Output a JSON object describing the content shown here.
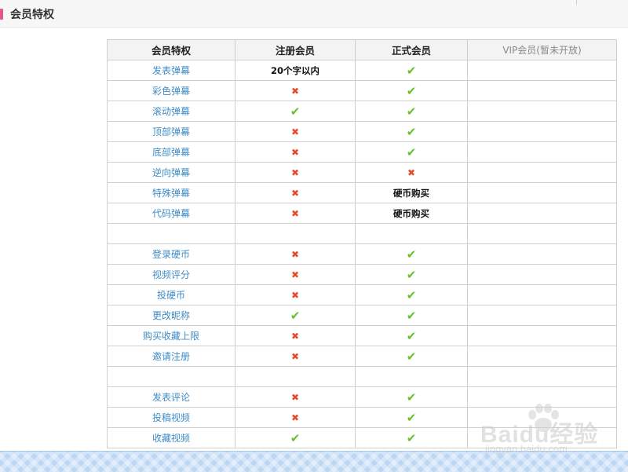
{
  "header": {
    "title": "会员特权"
  },
  "table": {
    "columns": [
      "会员特权",
      "注册会员",
      "正式会员",
      "VIP会员(暂未开放)"
    ],
    "rows": [
      {
        "feature": "发表弹幕",
        "registered": "20个字以内",
        "official": "yes",
        "vip": ""
      },
      {
        "feature": "彩色弹幕",
        "registered": "no",
        "official": "yes",
        "vip": ""
      },
      {
        "feature": "滚动弹幕",
        "registered": "yes",
        "official": "yes",
        "vip": ""
      },
      {
        "feature": "顶部弹幕",
        "registered": "no",
        "official": "yes",
        "vip": ""
      },
      {
        "feature": "底部弹幕",
        "registered": "no",
        "official": "yes",
        "vip": ""
      },
      {
        "feature": "逆向弹幕",
        "registered": "no",
        "official": "no",
        "vip": ""
      },
      {
        "feature": "特殊弹幕",
        "registered": "no",
        "official": "硬币购买",
        "vip": ""
      },
      {
        "feature": "代码弹幕",
        "registered": "no",
        "official": "硬币购买",
        "vip": ""
      },
      {
        "feature": "",
        "registered": "",
        "official": "",
        "vip": ""
      },
      {
        "feature": "登录硬币",
        "registered": "no",
        "official": "yes",
        "vip": ""
      },
      {
        "feature": "视频评分",
        "registered": "no",
        "official": "yes",
        "vip": ""
      },
      {
        "feature": "投硬币",
        "registered": "no",
        "official": "yes",
        "vip": ""
      },
      {
        "feature": "更改昵称",
        "registered": "yes",
        "official": "yes",
        "vip": ""
      },
      {
        "feature": "购买收藏上限",
        "registered": "no",
        "official": "yes",
        "vip": ""
      },
      {
        "feature": "邀请注册",
        "registered": "no",
        "official": "yes",
        "vip": ""
      },
      {
        "feature": "",
        "registered": "",
        "official": "",
        "vip": ""
      },
      {
        "feature": "发表评论",
        "registered": "no",
        "official": "yes",
        "vip": ""
      },
      {
        "feature": "投稿视频",
        "registered": "no",
        "official": "yes",
        "vip": ""
      },
      {
        "feature": "收藏视频",
        "registered": "yes",
        "official": "yes",
        "vip": ""
      }
    ]
  },
  "symbols": {
    "yes": "✔",
    "no": "✖"
  },
  "colors": {
    "yes": "#63c32d",
    "no": "#e84a2a",
    "feature_link": "#3f8cc7",
    "accent": "#e2578f"
  },
  "watermark": {
    "brand": "Baidu经验",
    "url": "jingyan.baidu.com"
  }
}
